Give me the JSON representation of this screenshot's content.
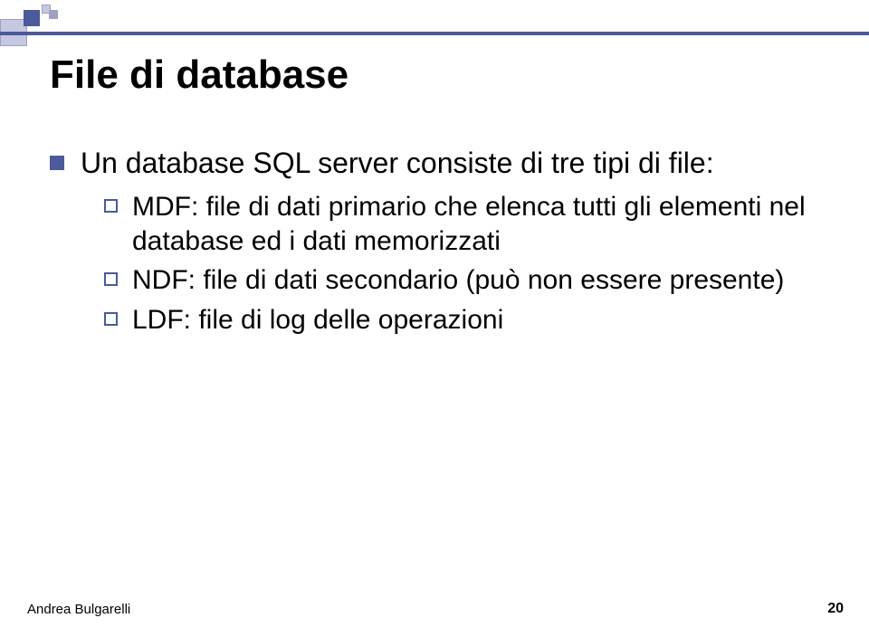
{
  "title": "File di database",
  "bullet1": "Un database SQL server consiste di tre tipi di file:",
  "sub": {
    "a": "MDF: file di dati primario che elenca tutti gli elementi nel database ed i dati memorizzati",
    "b": "NDF: file di dati secondario (può non essere presente)",
    "c": "LDF: file di log delle operazioni"
  },
  "footer": {
    "author": "Andrea Bulgarelli",
    "page": "20"
  }
}
